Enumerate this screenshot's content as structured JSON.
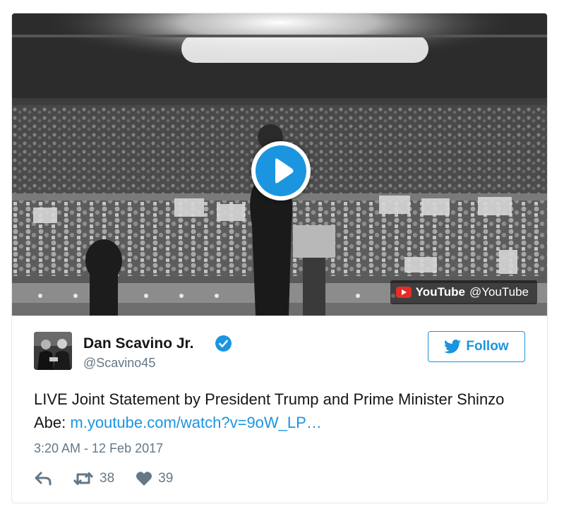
{
  "media": {
    "provider_brand": "YouTube",
    "provider_handle": "@YouTube",
    "icons": {
      "play": "play-icon",
      "provider": "youtube-logo-icon"
    }
  },
  "tweet": {
    "author": {
      "name": "Dan Scavino Jr.",
      "handle": "@Scavino45",
      "verified": true
    },
    "follow_label": "Follow",
    "text": "LIVE Joint Statement by President Trump and Prime Minister Shinzo Abe: ",
    "link_text": "m.youtube.com/watch?v=9oW_LP…",
    "timestamp": "3:20 AM - 12 Feb 2017",
    "retweet_count": "38",
    "like_count": "39"
  },
  "colors": {
    "accent": "#1b95e0",
    "text": "#14171a",
    "muted": "#657786",
    "border": "#e1e8ed",
    "youtube_red": "#e52d27"
  }
}
